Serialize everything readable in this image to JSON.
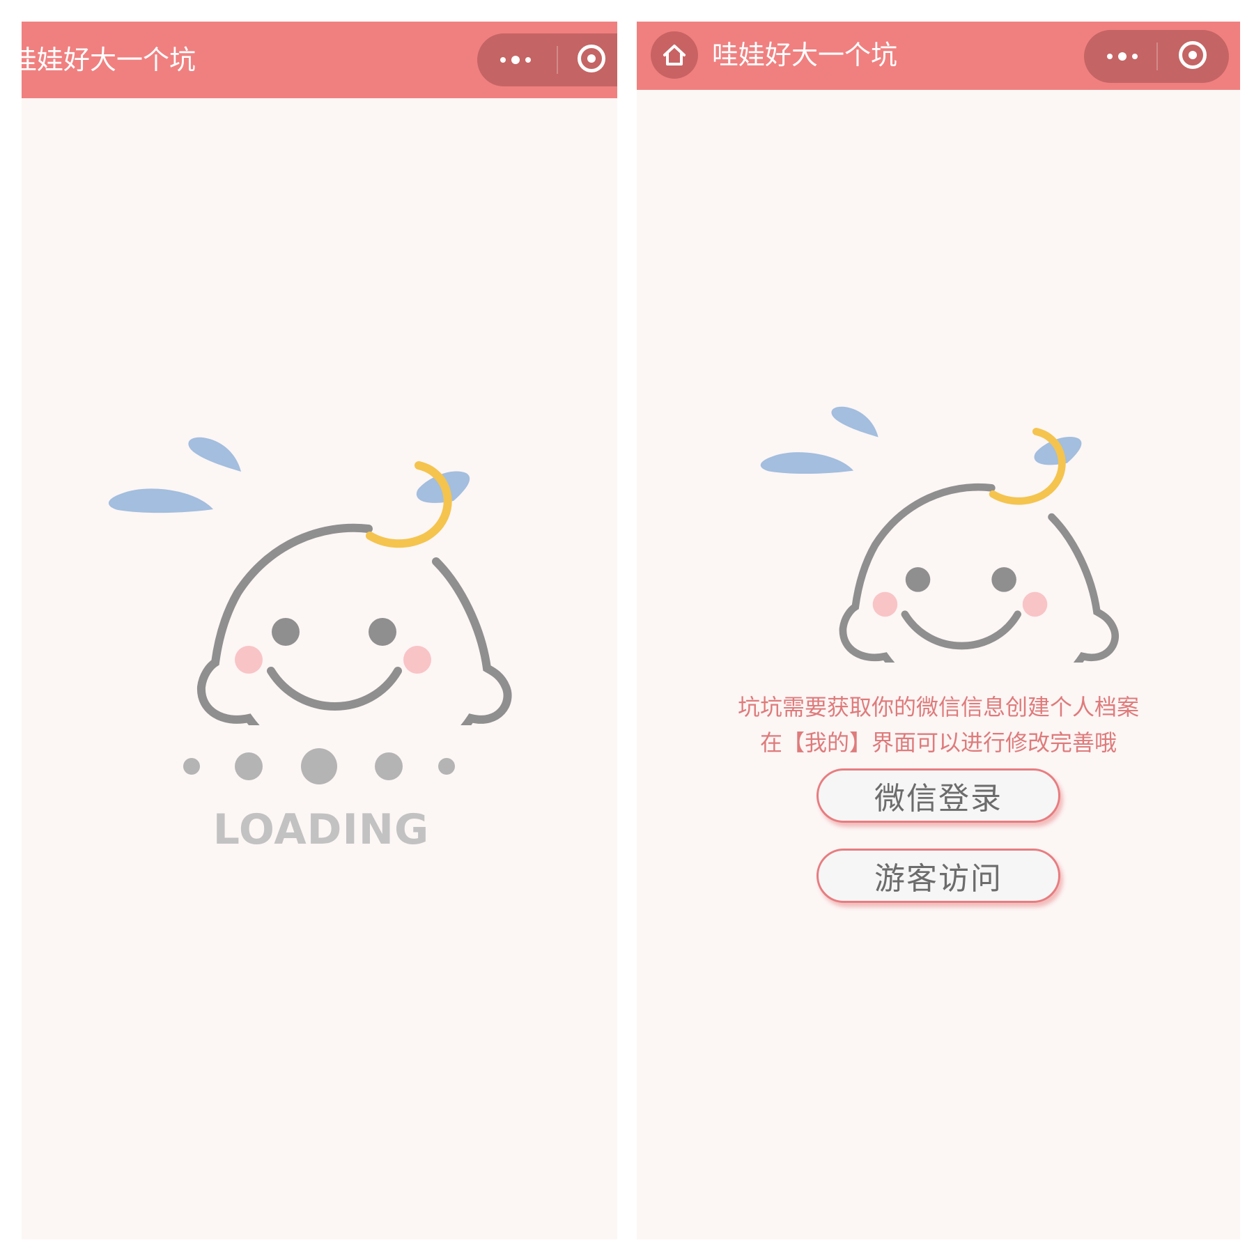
{
  "left_screen": {
    "title": "哇娃好大一个坑",
    "loading_text": "LOADING"
  },
  "right_screen": {
    "title": "哇娃好大一个坑",
    "message_line1": "坑坑需要获取你的微信信息创建个人档案",
    "message_line2": "在【我的】界面可以进行修改完善哦",
    "wechat_login_label": "微信登录",
    "guest_visit_label": "游客访问"
  },
  "colors": {
    "nav_bar": "#f08080",
    "capsule": "#c56464",
    "background": "#fcf6f5",
    "logo_gray": "#8f8f8f",
    "logo_blue": "#a3bede",
    "logo_yellow": "#f4c44e",
    "logo_pink": "#f9c4c6",
    "message_text": "#de7b7b",
    "button_border": "#e77d80"
  }
}
